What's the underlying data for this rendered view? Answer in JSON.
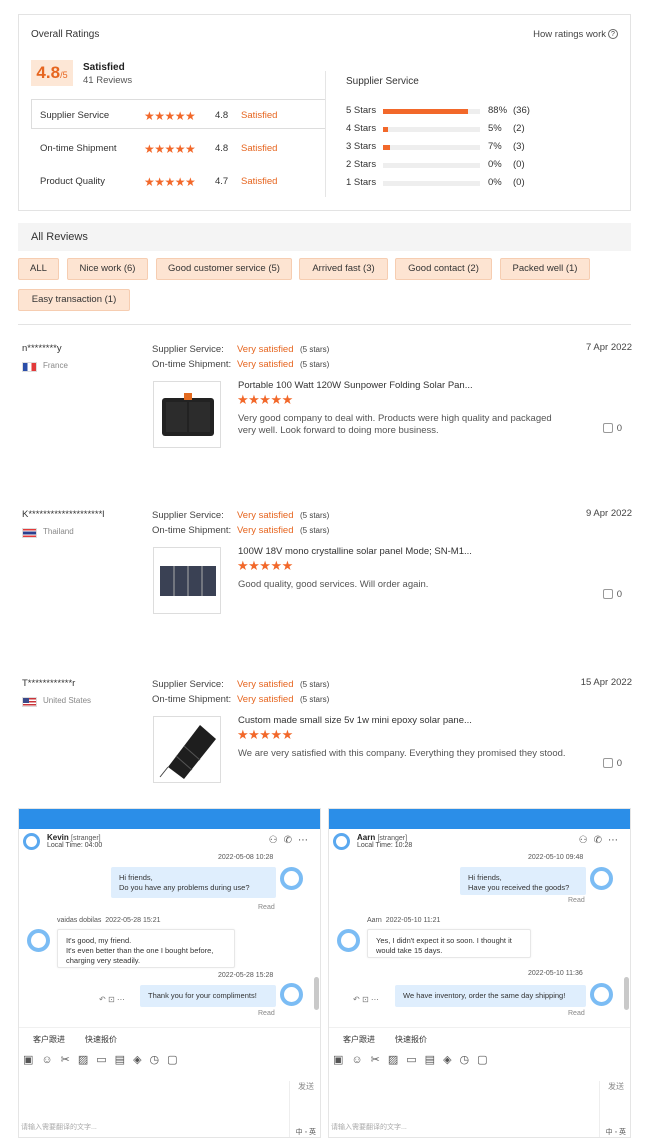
{
  "overall": {
    "title": "Overall Ratings",
    "how_link": "How ratings work",
    "score": "4.8",
    "score_suffix": "/5",
    "satisfied": "Satisfied",
    "reviews": "41 Reviews",
    "rows": [
      {
        "label": "Supplier Service",
        "stars": "★★★★★",
        "score": "4.8",
        "text": "Satisfied"
      },
      {
        "label": "On-time Shipment",
        "stars": "★★★★★",
        "score": "4.8",
        "text": "Satisfied"
      },
      {
        "label": "Product Quality",
        "stars": "★★★★★",
        "score": "4.7",
        "text": "Satisfied"
      }
    ],
    "supplier_title": "Supplier Service",
    "breakdown": [
      {
        "label": "5 Stars",
        "fraction": 0.88,
        "pct": "88%",
        "count": "(36)"
      },
      {
        "label": "4 Stars",
        "fraction": 0.05,
        "pct": "5%",
        "count": "(2)"
      },
      {
        "label": "3 Stars",
        "fraction": 0.07,
        "pct": "7%",
        "count": "(3)"
      },
      {
        "label": "2 Stars",
        "fraction": 0,
        "pct": "0%",
        "count": "(0)"
      },
      {
        "label": "1 Stars",
        "fraction": 0,
        "pct": "0%",
        "count": "(0)"
      }
    ]
  },
  "all_reviews": {
    "title": "All Reviews",
    "filters": [
      "ALL",
      "Nice work (6)",
      "Good customer service (5)",
      "Arrived fast (3)",
      "Good contact (2)",
      "Packed well (1)",
      "Easy transaction (1)"
    ]
  },
  "reviews": [
    {
      "user": "n********y",
      "country": "France",
      "l1": "Supplier Service:",
      "v1": "Very satisfied",
      "s1": "(5 stars)",
      "l2": "On-time Shipment:",
      "v2": "Very satisfied",
      "s2": "(5 stars)",
      "date": "7 Apr 2022",
      "product": "Portable 100 Watt 120W Sunpower Folding Solar Pan...",
      "stars": "★★★★★",
      "comment": "Very good company to deal with. Products were high quality and packaged very well. Look forward to doing more business.",
      "likes": "0"
    },
    {
      "user": "K********************l",
      "country": "Thailand",
      "l1": "Supplier Service:",
      "v1": "Very satisfied",
      "s1": "(5 stars)",
      "l2": "On-time Shipment:",
      "v2": "Very satisfied",
      "s2": "(5 stars)",
      "date": "9 Apr 2022",
      "product": "100W 18V mono crystalline solar panel Mode; SN-M1...",
      "stars": "★★★★★",
      "comment": "Good quality, good services. Will order again.",
      "likes": "0"
    },
    {
      "user": "T************r",
      "country": "United States",
      "l1": "Supplier Service:",
      "v1": "Very satisfied",
      "s1": "(5 stars)",
      "l2": "On-time Shipment:",
      "v2": "Very satisfied",
      "s2": "(5 stars)",
      "date": "15 Apr 2022",
      "product": "Custom made small size 5v 1w mini epoxy solar pane...",
      "stars": "★★★★★",
      "comment": "We are very satisfied with this company. Everything they promised they stood.",
      "likes": "0"
    }
  ],
  "chats": [
    {
      "name": "Kevin",
      "tag": "[stranger]",
      "local_time": "Local Time: 04:00",
      "ts1": "2022-05-08 10:28",
      "msg1": [
        "Hi friends,",
        "Do you have any problems during use?"
      ],
      "read1": "Read",
      "sender": "vaidas dobilas",
      "ts2": "2022-05-28 15:21",
      "msg2": [
        "It's good, my friend.",
        "It's even better than the one I bought before,",
        "charging very steadily."
      ],
      "ts3": "2022-05-28 15:28",
      "msg3": [
        "Thank you for your compliments!"
      ],
      "read3": "Read",
      "tab1": "客户跟进",
      "tab2": "快速报价",
      "send": "发送",
      "placeholder": "请输入需要翻译的文字...",
      "lang": "中 ◦ 英"
    },
    {
      "name": "Aarn",
      "tag": "[stranger]",
      "local_time": "Local Time: 10:28",
      "ts1": "2022-05-10 09:48",
      "msg1": [
        "Hi friends,",
        "Have you received the goods?"
      ],
      "read1": "Read",
      "sender": "Aarn",
      "ts2": "2022-05-10 11:21",
      "msg2": [
        "Yes, I didn't expect it so soon. I thought it",
        "would take 15 days."
      ],
      "ts3": "2022-05-10 11:36",
      "msg3": [
        "We have inventory, order the same day shipping!"
      ],
      "read3": "Read",
      "tab1": "客户跟进",
      "tab2": "快速报价",
      "send": "发送",
      "placeholder": "请输入需要翻译的文字...",
      "lang": "中 ◦ 英"
    }
  ]
}
